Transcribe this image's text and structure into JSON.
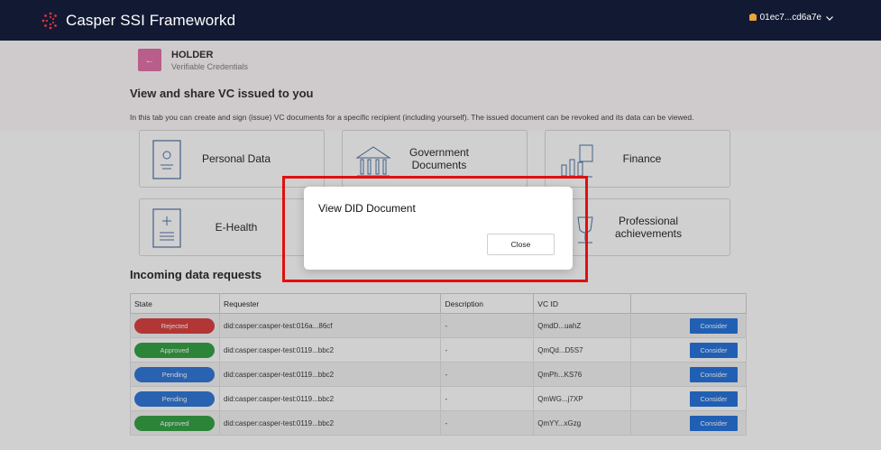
{
  "app": {
    "title": "Casper SSI Frameworkd",
    "account": "01ec7...cd6a7e"
  },
  "holder": {
    "back_label": "←",
    "title": "HOLDER",
    "subtitle": "Verifiable Credentials"
  },
  "section": {
    "title": "View and share VC issued to you",
    "intro": "In this tab you can create and sign (issue) VC documents for a specific recipient (including yourself). The issued document can be revoked and its data can be viewed."
  },
  "cards": {
    "personal": "Personal Data",
    "government_1": "Government",
    "government_2": "Documents",
    "finance": "Finance",
    "ehealth": "E-Health",
    "professional_1": "Professional",
    "professional_2": "achievements"
  },
  "incoming": {
    "title": "Incoming data requests",
    "columns": [
      "State",
      "Requester",
      "Description",
      "VC ID",
      ""
    ],
    "rows": [
      {
        "state": "Rejected",
        "requester": "did:casper:casper-test:016a...86cf",
        "description": "-",
        "vc_id": "QmdD...uahZ",
        "action": "Consider"
      },
      {
        "state": "Approved",
        "requester": "did:casper:casper-test:0119...bbc2",
        "description": "-",
        "vc_id": "QmQd...D5S7",
        "action": "Consider"
      },
      {
        "state": "Pending",
        "requester": "did:casper:casper-test:0119...bbc2",
        "description": "-",
        "vc_id": "QmPh...KS76",
        "action": "Consider"
      },
      {
        "state": "Pending",
        "requester": "did:casper:casper-test:0119...bbc2",
        "description": "-",
        "vc_id": "QmWG...j7XP",
        "action": "Consider"
      },
      {
        "state": "Approved",
        "requester": "did:casper:casper-test:0119...bbc2",
        "description": "-",
        "vc_id": "QmYY...xGzg",
        "action": "Consider"
      }
    ]
  },
  "modal": {
    "title": "View DID Document",
    "close_label": "Close"
  },
  "colors": {
    "topbar": "#121a33",
    "accent_pink": "#e06aa6",
    "rejected": "#d93a3a",
    "approved": "#2e9e3e",
    "pending": "#2a72d6",
    "consider": "#1f6fdc",
    "highlight": "#e01010"
  },
  "icons": {
    "brand": "casper-logo-icon",
    "account": "wallet-icon",
    "chevron": "chevron-down-icon"
  }
}
